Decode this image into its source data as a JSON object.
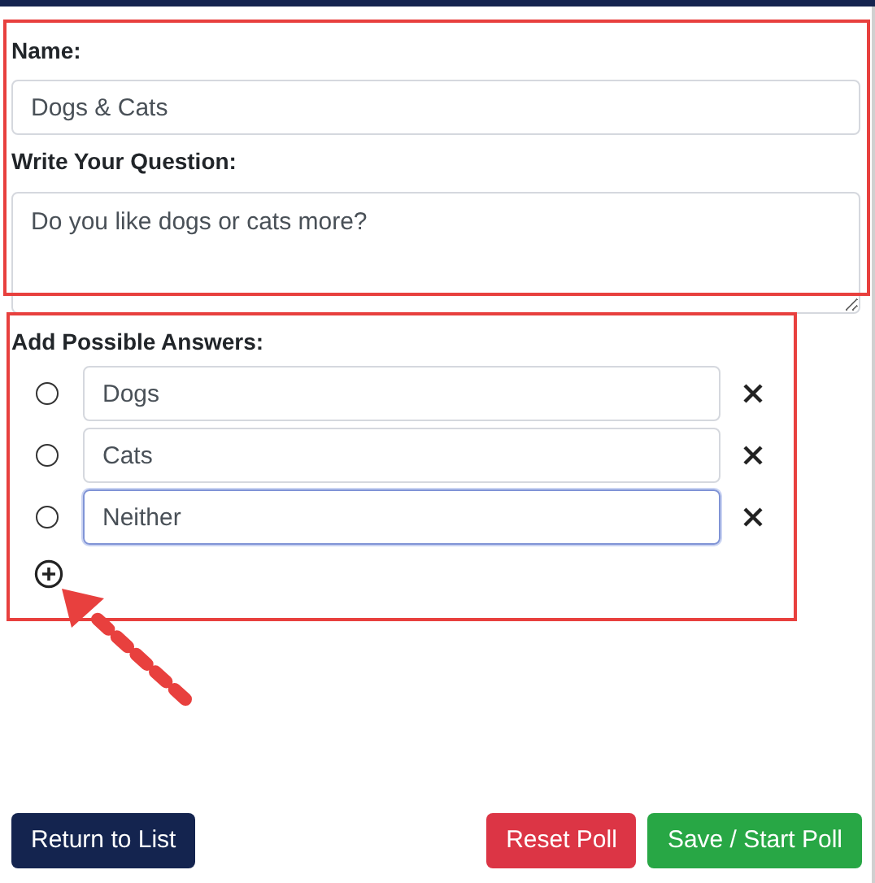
{
  "name_field": {
    "label": "Name:",
    "value": "Dogs & Cats"
  },
  "question_field": {
    "label": "Write Your Question:",
    "value": "Do you like dogs or cats more?"
  },
  "answers": {
    "label": "Add Possible Answers:",
    "items": [
      {
        "value": "Dogs",
        "selected": false,
        "focused": false
      },
      {
        "value": "Cats",
        "selected": false,
        "focused": false
      },
      {
        "value": "Neither",
        "selected": false,
        "focused": true
      }
    ]
  },
  "buttons": [
    {
      "label": "Return to List",
      "kind": "secondary"
    },
    {
      "label": "Reset Poll",
      "kind": "danger"
    },
    {
      "label": "Save / Start Poll",
      "kind": "success"
    }
  ]
}
